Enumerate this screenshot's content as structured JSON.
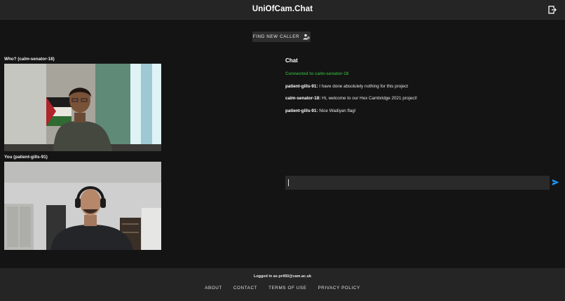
{
  "header": {
    "title": "UniOfCam.Chat",
    "logout_icon": "logout-icon"
  },
  "find_button": {
    "label": "FIND NEW CALLER",
    "icon": "person-search-icon"
  },
  "videos": {
    "remote_label": "Who? (calm-senator-18)",
    "local_label": "You (patient-gills-91)"
  },
  "chat": {
    "title": "Chat",
    "status": "Connected to calm-senator-18",
    "messages": [
      {
        "sender": "patient-gills-91:",
        "text": " I have done absolutely nothing for this project"
      },
      {
        "sender": "calm-senator-18:",
        "text": " Hi, welcome to our Hex Cambridge 2021 project!"
      },
      {
        "sender": "patient-gills-91:",
        "text": " Nice Wadiyan flag!"
      }
    ],
    "input_value": "",
    "send_icon": "send-icon"
  },
  "footer": {
    "logged_in": "Logged in as pr450@cam.ac.uk",
    "links": [
      "ABOUT",
      "CONTACT",
      "TERMS OF USE",
      "PRIVACY POLICY"
    ]
  },
  "colors": {
    "background": "#141414",
    "bar": "#252525",
    "status_green": "#2e9b35",
    "send_blue": "#2196f3"
  }
}
